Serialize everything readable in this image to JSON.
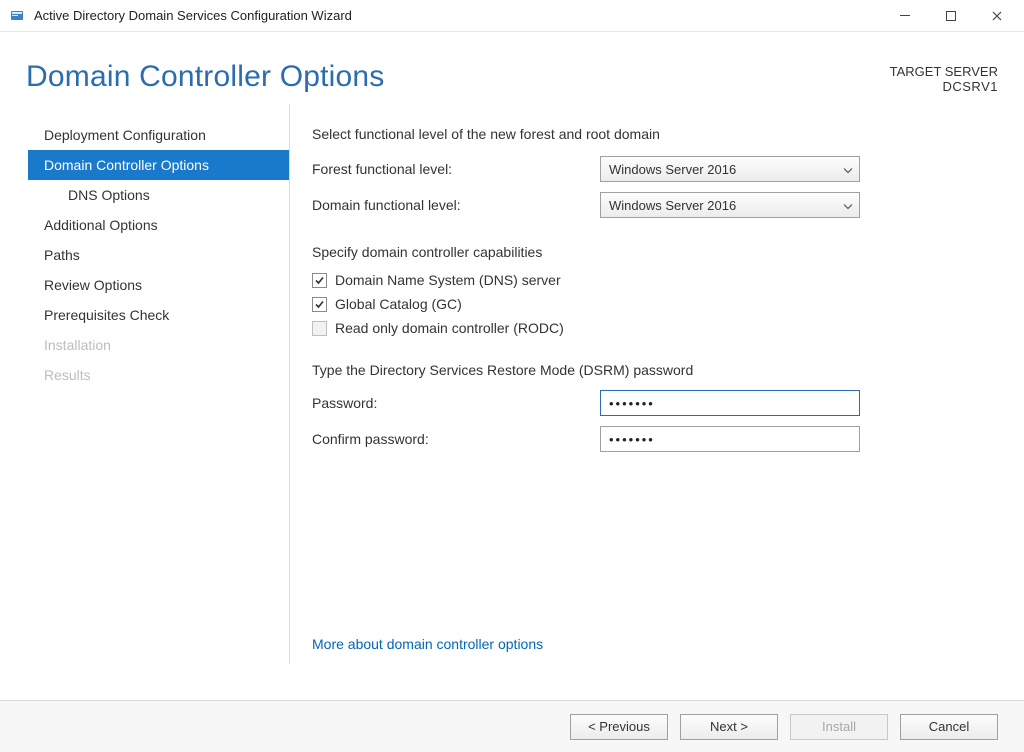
{
  "titlebar": {
    "title": "Active Directory Domain Services Configuration Wizard"
  },
  "header": {
    "page_title": "Domain Controller Options",
    "target_label": "TARGET SERVER",
    "target_server": "DCSRV1"
  },
  "sidebar": {
    "items": [
      {
        "label": "Deployment Configuration",
        "active": false,
        "disabled": false
      },
      {
        "label": "Domain Controller Options",
        "active": true,
        "disabled": false
      },
      {
        "label": "DNS Options",
        "active": false,
        "disabled": false,
        "sub": true
      },
      {
        "label": "Additional Options",
        "active": false,
        "disabled": false
      },
      {
        "label": "Paths",
        "active": false,
        "disabled": false
      },
      {
        "label": "Review Options",
        "active": false,
        "disabled": false
      },
      {
        "label": "Prerequisites Check",
        "active": false,
        "disabled": false
      },
      {
        "label": "Installation",
        "active": false,
        "disabled": true
      },
      {
        "label": "Results",
        "active": false,
        "disabled": true
      }
    ]
  },
  "content": {
    "section1_label": "Select functional level of the new forest and root domain",
    "forest_label": "Forest functional level:",
    "forest_value": "Windows Server 2016",
    "domain_label": "Domain functional level:",
    "domain_value": "Windows Server 2016",
    "capabilities_label": "Specify domain controller capabilities",
    "cap_dns": "Domain Name System (DNS) server",
    "cap_gc": "Global Catalog (GC)",
    "cap_rodc": "Read only domain controller (RODC)",
    "dsrm_label": "Type the Directory Services Restore Mode (DSRM) password",
    "password_label": "Password:",
    "password_value": "•••••••",
    "confirm_label": "Confirm password:",
    "confirm_value": "•••••••",
    "more_link": "More about domain controller options"
  },
  "footer": {
    "previous": "< Previous",
    "next": "Next >",
    "install": "Install",
    "cancel": "Cancel"
  }
}
